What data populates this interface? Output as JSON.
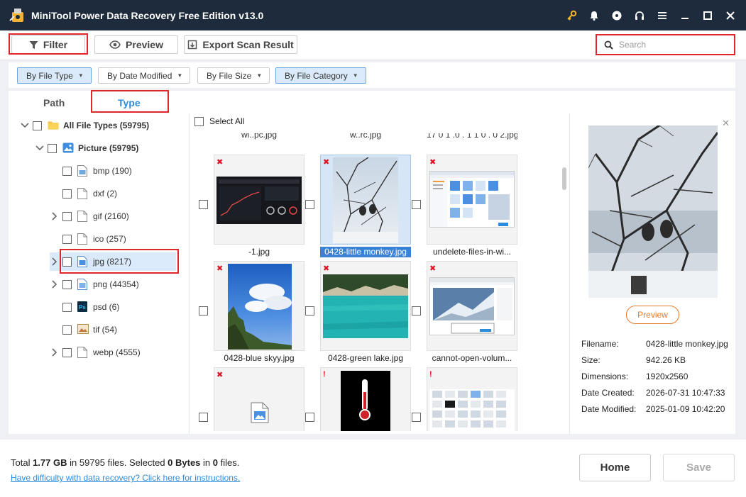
{
  "app": {
    "title": "MiniTool Power Data Recovery Free Edition v13.0"
  },
  "title_icons": [
    "key-icon",
    "bell-icon",
    "disc-icon",
    "headset-icon",
    "menu-icon",
    "minimize-icon",
    "maximize-icon",
    "close-icon"
  ],
  "toolbar": {
    "filter_label": "Filter",
    "preview_label": "Preview",
    "export_label": "Export Scan Result",
    "search_placeholder": "Search"
  },
  "filters": [
    {
      "label": "By File Type",
      "active": true
    },
    {
      "label": "By Date Modified",
      "active": false
    },
    {
      "label": "By File Size",
      "active": false
    },
    {
      "label": "By File Category",
      "active": true
    }
  ],
  "tabs": {
    "path": "Path",
    "type": "Type"
  },
  "tree": {
    "root": "All File Types (59795)",
    "picture": "Picture (59795)",
    "items": [
      {
        "label": "bmp (190)",
        "icon": "image-file-icon",
        "expandable": false
      },
      {
        "label": "dxf (2)",
        "icon": "blank-file-icon",
        "expandable": false
      },
      {
        "label": "gif (2160)",
        "icon": "blank-file-icon",
        "expandable": true
      },
      {
        "label": "ico (257)",
        "icon": "blank-file-icon",
        "expandable": false
      },
      {
        "label": "jpg (8217)",
        "icon": "jpg-file-icon",
        "expandable": true
      },
      {
        "label": "png (44354)",
        "icon": "png-file-icon",
        "expandable": true
      },
      {
        "label": "psd (6)",
        "icon": "psd-file-icon",
        "expandable": false
      },
      {
        "label": "tif (54)",
        "icon": "tif-file-icon",
        "expandable": false
      },
      {
        "label": "webp (4555)",
        "icon": "blank-file-icon",
        "expandable": true
      }
    ]
  },
  "grid": {
    "select_all": "Select All",
    "top_captions": [
      "wi..pc.jpg",
      "w..rc.jpg",
      "17 0 1 .0 . 1 1 0 . 0 2.jpg"
    ],
    "files": [
      {
        "name": "-1.jpg",
        "mark": "✖",
        "thumb": "dark-dashboard"
      },
      {
        "name": "0428-little monkey.jpg",
        "mark": "✖",
        "thumb": "snow-monkey",
        "selected": true
      },
      {
        "name": "undelete-files-in-wi...",
        "mark": "✖",
        "thumb": "explorer-window"
      },
      {
        "name": "0428-blue skyy.jpg",
        "mark": "✖",
        "thumb": "blue-sky"
      },
      {
        "name": "0428-green lake.jpg",
        "mark": "✖",
        "thumb": "green-lake"
      },
      {
        "name": "cannot-open-volum...",
        "mark": "✖",
        "thumb": "browser-window"
      },
      {
        "name": "",
        "mark": "✖",
        "thumb": "generic-image"
      },
      {
        "name": "",
        "mark": "!",
        "thumb": "thermometer"
      },
      {
        "name": "",
        "mark": "!",
        "thumb": "icon-grid"
      }
    ]
  },
  "preview_panel": {
    "button": "Preview",
    "fields": [
      {
        "key": "Filename:",
        "value": "0428-little monkey.jpg"
      },
      {
        "key": "Size:",
        "value": "942.26 KB"
      },
      {
        "key": "Dimensions:",
        "value": "1920x2560"
      },
      {
        "key": "Date Created:",
        "value": "2026-07-31 10:47:33"
      },
      {
        "key": "Date Modified:",
        "value": "2025-01-09 10:42:20"
      }
    ]
  },
  "footer": {
    "total_prefix": "Total ",
    "total_size": "1.77 GB",
    "in_word": " in ",
    "total_files": "59795",
    "files_selected_mid": " files.  Selected ",
    "selected_size": "0 Bytes",
    "in_word2": " in ",
    "selected_files": "0",
    "files_end": " files.",
    "help_link": "Have difficulty with data recovery? Click here for instructions.",
    "home_label": "Home",
    "save_label": "Save"
  }
}
